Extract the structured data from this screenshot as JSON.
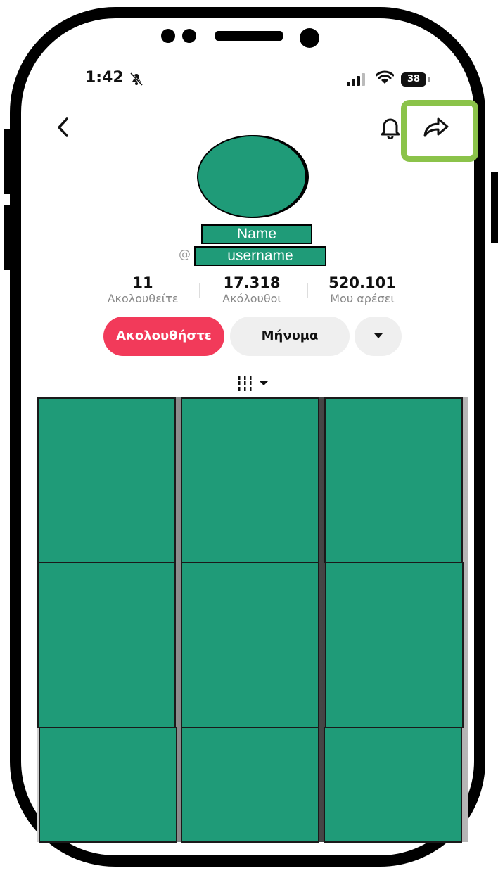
{
  "status_bar": {
    "time": "1:42",
    "battery": "38"
  },
  "icons": {
    "back": "chevron-left-icon",
    "bell": "bell-icon",
    "share": "share-arrow-icon",
    "silent": "bell-slash-icon",
    "signal": "signal-icon",
    "wifi": "wifi-icon",
    "grid": "grid-filter-icon"
  },
  "profile": {
    "name": "Name",
    "username_prefix": "@",
    "username": "username"
  },
  "stats": [
    {
      "value": "11",
      "label": "Ακολουθείτε"
    },
    {
      "value": "17.318",
      "label": "Ακόλουθοι"
    },
    {
      "value": "520.101",
      "label": "Μου αρέσει"
    }
  ],
  "actions": {
    "follow": "Ακολουθήστε",
    "message": "Μήνυμα"
  },
  "colors": {
    "redaction": "#1f9b78",
    "follow_button": "#f23a5a",
    "highlight": "#8bc34a"
  },
  "video_count": 9
}
